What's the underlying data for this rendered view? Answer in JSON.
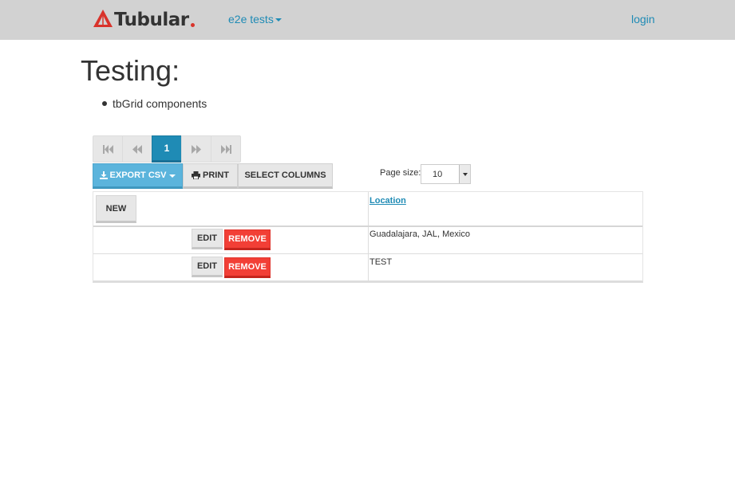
{
  "navbar": {
    "brand": "Tubular",
    "menu_label": "e2e tests",
    "login_label": "login"
  },
  "main": {
    "title": "Testing:",
    "bullets": [
      "tbGrid components"
    ]
  },
  "pager": {
    "current_page": "1"
  },
  "toolbar": {
    "export_label": "EXPORT CSV",
    "print_label": "PRINT",
    "select_columns_label": "SELECT COLUMNS",
    "page_size_label": "Page size:",
    "page_size_value": "10"
  },
  "grid": {
    "new_label": "NEW",
    "columns": [
      "Location"
    ],
    "rows": [
      {
        "edit": "EDIT",
        "remove": "REMOVE",
        "location": "Guadalajara, JAL, Mexico"
      },
      {
        "edit": "EDIT",
        "remove": "REMOVE",
        "location": "TEST"
      }
    ]
  },
  "colors": {
    "navbar_bg": "#d2d2d2",
    "accent": "#1f8bb5",
    "export_button": "#5bb4dc",
    "danger": "#f23f36",
    "brand_dot": "#d9332b"
  },
  "icons": {
    "brand": "tubular-logo-icon",
    "first": "step-backward-icon",
    "prev": "backward-icon",
    "next": "forward-icon",
    "last": "step-forward-icon",
    "export": "download-icon",
    "print": "print-icon"
  }
}
